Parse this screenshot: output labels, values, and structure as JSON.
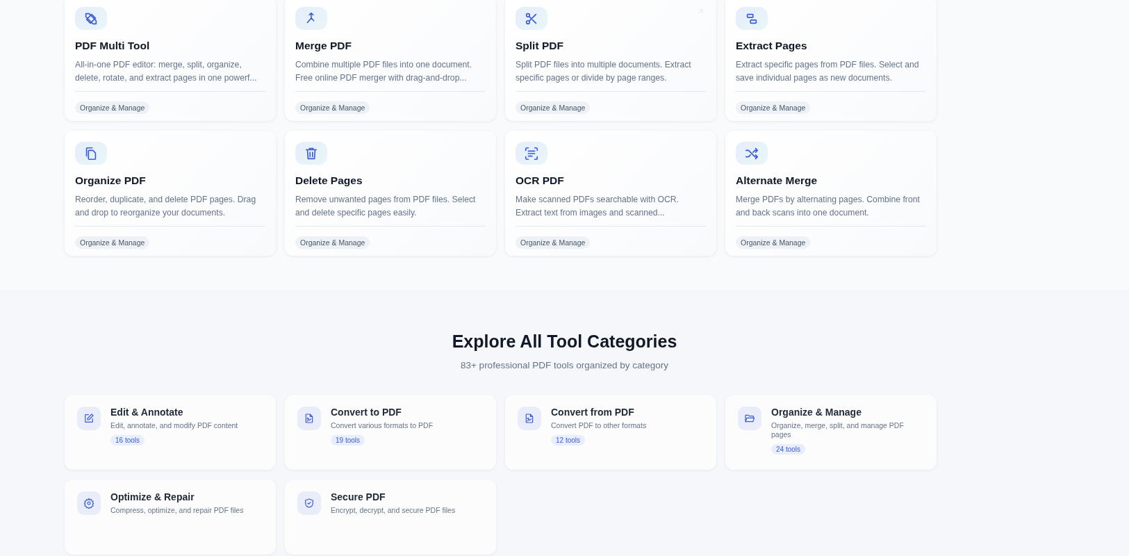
{
  "tools": [
    {
      "title": "PDF Multi Tool",
      "description": "All-in-one PDF editor: merge, split, organize, delete, rotate, and extract pages in one powerf...",
      "tag": "Organize & Manage",
      "hovered": false
    },
    {
      "title": "Merge PDF",
      "description": "Combine multiple PDF files into one document. Free online PDF merger with drag-and-drop...",
      "tag": "Organize & Manage",
      "hovered": false
    },
    {
      "title": "Split PDF",
      "description": "Split PDF files into multiple documents. Extract specific pages or divide by page ranges.",
      "tag": "Organize & Manage",
      "hovered": true
    },
    {
      "title": "Extract Pages",
      "description": "Extract specific pages from PDF files. Select and save individual pages as new documents.",
      "tag": "Organize & Manage",
      "hovered": false
    },
    {
      "title": "Organize PDF",
      "description": "Reorder, duplicate, and delete PDF pages. Drag and drop to reorganize your documents.",
      "tag": "Organize & Manage",
      "hovered": false
    },
    {
      "title": "Delete Pages",
      "description": "Remove unwanted pages from PDF files. Select and delete specific pages easily.",
      "tag": "Organize & Manage",
      "hovered": false
    },
    {
      "title": "OCR PDF",
      "description": "Make scanned PDFs searchable with OCR. Extract text from images and scanned...",
      "tag": "Organize & Manage",
      "hovered": false
    },
    {
      "title": "Alternate Merge",
      "description": "Merge PDFs by alternating pages. Combine front and back scans into one document.",
      "tag": "Organize & Manage",
      "hovered": false
    }
  ],
  "categories_section": {
    "title": "Explore All Tool Categories",
    "subtitle": "83+ professional PDF tools organized by category"
  },
  "categories": [
    {
      "title": "Edit & Annotate",
      "description": "Edit, annotate, and modify PDF content",
      "count": "16 tools"
    },
    {
      "title": "Convert to PDF",
      "description": "Convert various formats to PDF",
      "count": "19 tools"
    },
    {
      "title": "Convert from PDF",
      "description": "Convert PDF to other formats",
      "count": "12 tools"
    },
    {
      "title": "Organize & Manage",
      "description": "Organize, merge, split, and manage PDF pages",
      "count": "24 tools"
    },
    {
      "title": "Optimize & Repair",
      "description": "Compress, optimize, and repair PDF files"
    },
    {
      "title": "Secure PDF",
      "description": "Encrypt, decrypt, and secure PDF files"
    }
  ]
}
